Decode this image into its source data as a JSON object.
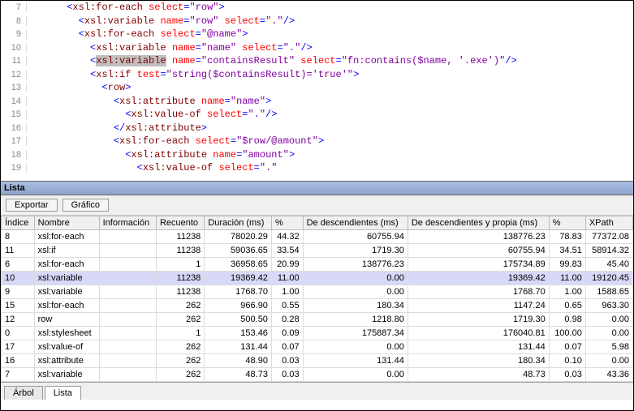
{
  "code": {
    "lines": [
      {
        "n": 7,
        "indent": 6,
        "type": "open",
        "el": "xsl:for-each",
        "attrs": [
          {
            "k": "select",
            "v": "row"
          }
        ]
      },
      {
        "n": 8,
        "indent": 8,
        "type": "selfclose",
        "el": "xsl:variable",
        "attrs": [
          {
            "k": "name",
            "v": "row"
          },
          {
            "k": "select",
            "v": "."
          }
        ]
      },
      {
        "n": 9,
        "indent": 8,
        "type": "open",
        "el": "xsl:for-each",
        "attrs": [
          {
            "k": "select",
            "v": "@name"
          }
        ]
      },
      {
        "n": 10,
        "indent": 10,
        "type": "selfclose",
        "el": "xsl:variable",
        "attrs": [
          {
            "k": "name",
            "v": "name"
          },
          {
            "k": "select",
            "v": "."
          }
        ]
      },
      {
        "n": 11,
        "indent": 10,
        "type": "selfclose",
        "el": "xsl:variable",
        "attrs": [
          {
            "k": "name",
            "v": "containsResult"
          },
          {
            "k": "select",
            "v": "fn:contains($name, '.exe')"
          }
        ],
        "highlight": true
      },
      {
        "n": 12,
        "indent": 10,
        "type": "open",
        "el": "xsl:if",
        "attrs": [
          {
            "k": "test",
            "v": "string($containsResult)='true'"
          }
        ]
      },
      {
        "n": 13,
        "indent": 12,
        "type": "open",
        "el": "row",
        "attrs": []
      },
      {
        "n": 14,
        "indent": 14,
        "type": "open",
        "el": "xsl:attribute",
        "attrs": [
          {
            "k": "name",
            "v": "name"
          }
        ]
      },
      {
        "n": 15,
        "indent": 16,
        "type": "selfclose",
        "el": "xsl:value-of",
        "attrs": [
          {
            "k": "select",
            "v": "."
          }
        ]
      },
      {
        "n": 16,
        "indent": 14,
        "type": "close",
        "el": "xsl:attribute"
      },
      {
        "n": 17,
        "indent": 14,
        "type": "open",
        "el": "xsl:for-each",
        "attrs": [
          {
            "k": "select",
            "v": "$row/@amount"
          }
        ]
      },
      {
        "n": 18,
        "indent": 16,
        "type": "open",
        "el": "xsl:attribute",
        "attrs": [
          {
            "k": "name",
            "v": "amount"
          }
        ]
      },
      {
        "n": 19,
        "indent": 18,
        "type": "selfclose",
        "el": "xsl:value-of",
        "attrs": [
          {
            "k": "select",
            "v": "."
          }
        ],
        "cut": true
      }
    ]
  },
  "panel": {
    "title": "Lista"
  },
  "toolbar": {
    "export_label": "Exportar",
    "chart_label": "Gráfico"
  },
  "grid": {
    "headers": {
      "index": "Índice",
      "name": "Nombre",
      "info": "Información",
      "count": "Recuento",
      "duration": "Duración (ms)",
      "pct": "%",
      "desc": "De descendientes (ms)",
      "desc_self": "De descendientes y propia (ms)",
      "pct2": "%",
      "xpath": "XPath"
    },
    "rows": [
      {
        "idx": "8",
        "name": "xsl:for-each",
        "info": "",
        "count": "11238",
        "dur": "78020.29",
        "pct": "44.32",
        "desc": "60755.94",
        "descself": "138776.23",
        "pct2": "78.83",
        "xpath": "77372.08"
      },
      {
        "idx": "11",
        "name": "xsl:if",
        "info": "",
        "count": "11238",
        "dur": "59036.65",
        "pct": "33.54",
        "desc": "1719.30",
        "descself": "60755.94",
        "pct2": "34.51",
        "xpath": "58914.32"
      },
      {
        "idx": "6",
        "name": "xsl:for-each",
        "info": "",
        "count": "1",
        "dur": "36958.65",
        "pct": "20.99",
        "desc": "138776.23",
        "descself": "175734.89",
        "pct2": "99.83",
        "xpath": "45.40"
      },
      {
        "idx": "10",
        "name": "xsl:variable",
        "info": "",
        "count": "11238",
        "dur": "19369.42",
        "pct": "11.00",
        "desc": "0.00",
        "descself": "19369.42",
        "pct2": "11.00",
        "xpath": "19120.45",
        "sel": true
      },
      {
        "idx": "9",
        "name": "xsl:variable",
        "info": "",
        "count": "11238",
        "dur": "1768.70",
        "pct": "1.00",
        "desc": "0.00",
        "descself": "1768.70",
        "pct2": "1.00",
        "xpath": "1588.65"
      },
      {
        "idx": "15",
        "name": "xsl:for-each",
        "info": "",
        "count": "262",
        "dur": "966.90",
        "pct": "0.55",
        "desc": "180.34",
        "descself": "1147.24",
        "pct2": "0.65",
        "xpath": "963.30"
      },
      {
        "idx": "12",
        "name": "row",
        "info": "",
        "count": "262",
        "dur": "500.50",
        "pct": "0.28",
        "desc": "1218.80",
        "descself": "1719.30",
        "pct2": "0.98",
        "xpath": "0.00"
      },
      {
        "idx": "0",
        "name": "xsl:stylesheet",
        "info": "",
        "count": "1",
        "dur": "153.46",
        "pct": "0.09",
        "desc": "175887.34",
        "descself": "176040.81",
        "pct2": "100.00",
        "xpath": "0.00"
      },
      {
        "idx": "17",
        "name": "xsl:value-of",
        "info": "",
        "count": "262",
        "dur": "131.44",
        "pct": "0.07",
        "desc": "0.00",
        "descself": "131.44",
        "pct2": "0.07",
        "xpath": "5.98"
      },
      {
        "idx": "16",
        "name": "xsl:attribute",
        "info": "",
        "count": "262",
        "dur": "48.90",
        "pct": "0.03",
        "desc": "131.44",
        "descself": "180.34",
        "pct2": "0.10",
        "xpath": "0.00"
      },
      {
        "idx": "7",
        "name": "xsl:variable",
        "info": "",
        "count": "262",
        "dur": "48.73",
        "pct": "0.03",
        "desc": "0.00",
        "descself": "48.73",
        "pct2": "0.03",
        "xpath": "43.36"
      }
    ]
  },
  "tabs": {
    "tree": "Árbol",
    "list": "Lista"
  }
}
